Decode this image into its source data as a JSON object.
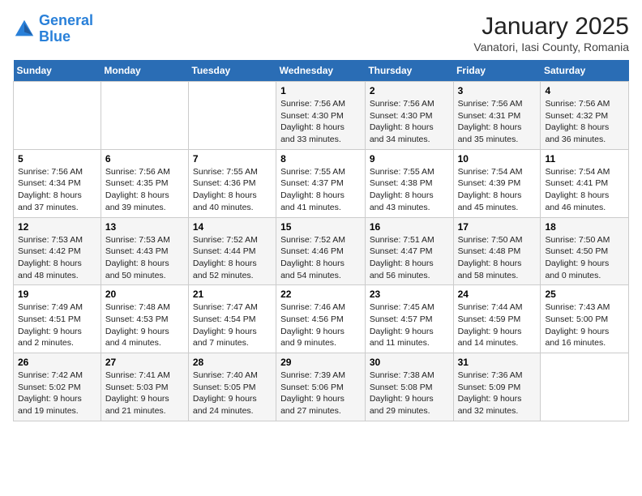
{
  "header": {
    "logo_line1": "General",
    "logo_line2": "Blue",
    "month": "January 2025",
    "location": "Vanatori, Iasi County, Romania"
  },
  "weekdays": [
    "Sunday",
    "Monday",
    "Tuesday",
    "Wednesday",
    "Thursday",
    "Friday",
    "Saturday"
  ],
  "weeks": [
    [
      {
        "day": "",
        "detail": ""
      },
      {
        "day": "",
        "detail": ""
      },
      {
        "day": "",
        "detail": ""
      },
      {
        "day": "1",
        "detail": "Sunrise: 7:56 AM\nSunset: 4:30 PM\nDaylight: 8 hours\nand 33 minutes."
      },
      {
        "day": "2",
        "detail": "Sunrise: 7:56 AM\nSunset: 4:30 PM\nDaylight: 8 hours\nand 34 minutes."
      },
      {
        "day": "3",
        "detail": "Sunrise: 7:56 AM\nSunset: 4:31 PM\nDaylight: 8 hours\nand 35 minutes."
      },
      {
        "day": "4",
        "detail": "Sunrise: 7:56 AM\nSunset: 4:32 PM\nDaylight: 8 hours\nand 36 minutes."
      }
    ],
    [
      {
        "day": "5",
        "detail": "Sunrise: 7:56 AM\nSunset: 4:34 PM\nDaylight: 8 hours\nand 37 minutes."
      },
      {
        "day": "6",
        "detail": "Sunrise: 7:56 AM\nSunset: 4:35 PM\nDaylight: 8 hours\nand 39 minutes."
      },
      {
        "day": "7",
        "detail": "Sunrise: 7:55 AM\nSunset: 4:36 PM\nDaylight: 8 hours\nand 40 minutes."
      },
      {
        "day": "8",
        "detail": "Sunrise: 7:55 AM\nSunset: 4:37 PM\nDaylight: 8 hours\nand 41 minutes."
      },
      {
        "day": "9",
        "detail": "Sunrise: 7:55 AM\nSunset: 4:38 PM\nDaylight: 8 hours\nand 43 minutes."
      },
      {
        "day": "10",
        "detail": "Sunrise: 7:54 AM\nSunset: 4:39 PM\nDaylight: 8 hours\nand 45 minutes."
      },
      {
        "day": "11",
        "detail": "Sunrise: 7:54 AM\nSunset: 4:41 PM\nDaylight: 8 hours\nand 46 minutes."
      }
    ],
    [
      {
        "day": "12",
        "detail": "Sunrise: 7:53 AM\nSunset: 4:42 PM\nDaylight: 8 hours\nand 48 minutes."
      },
      {
        "day": "13",
        "detail": "Sunrise: 7:53 AM\nSunset: 4:43 PM\nDaylight: 8 hours\nand 50 minutes."
      },
      {
        "day": "14",
        "detail": "Sunrise: 7:52 AM\nSunset: 4:44 PM\nDaylight: 8 hours\nand 52 minutes."
      },
      {
        "day": "15",
        "detail": "Sunrise: 7:52 AM\nSunset: 4:46 PM\nDaylight: 8 hours\nand 54 minutes."
      },
      {
        "day": "16",
        "detail": "Sunrise: 7:51 AM\nSunset: 4:47 PM\nDaylight: 8 hours\nand 56 minutes."
      },
      {
        "day": "17",
        "detail": "Sunrise: 7:50 AM\nSunset: 4:48 PM\nDaylight: 8 hours\nand 58 minutes."
      },
      {
        "day": "18",
        "detail": "Sunrise: 7:50 AM\nSunset: 4:50 PM\nDaylight: 9 hours\nand 0 minutes."
      }
    ],
    [
      {
        "day": "19",
        "detail": "Sunrise: 7:49 AM\nSunset: 4:51 PM\nDaylight: 9 hours\nand 2 minutes."
      },
      {
        "day": "20",
        "detail": "Sunrise: 7:48 AM\nSunset: 4:53 PM\nDaylight: 9 hours\nand 4 minutes."
      },
      {
        "day": "21",
        "detail": "Sunrise: 7:47 AM\nSunset: 4:54 PM\nDaylight: 9 hours\nand 7 minutes."
      },
      {
        "day": "22",
        "detail": "Sunrise: 7:46 AM\nSunset: 4:56 PM\nDaylight: 9 hours\nand 9 minutes."
      },
      {
        "day": "23",
        "detail": "Sunrise: 7:45 AM\nSunset: 4:57 PM\nDaylight: 9 hours\nand 11 minutes."
      },
      {
        "day": "24",
        "detail": "Sunrise: 7:44 AM\nSunset: 4:59 PM\nDaylight: 9 hours\nand 14 minutes."
      },
      {
        "day": "25",
        "detail": "Sunrise: 7:43 AM\nSunset: 5:00 PM\nDaylight: 9 hours\nand 16 minutes."
      }
    ],
    [
      {
        "day": "26",
        "detail": "Sunrise: 7:42 AM\nSunset: 5:02 PM\nDaylight: 9 hours\nand 19 minutes."
      },
      {
        "day": "27",
        "detail": "Sunrise: 7:41 AM\nSunset: 5:03 PM\nDaylight: 9 hours\nand 21 minutes."
      },
      {
        "day": "28",
        "detail": "Sunrise: 7:40 AM\nSunset: 5:05 PM\nDaylight: 9 hours\nand 24 minutes."
      },
      {
        "day": "29",
        "detail": "Sunrise: 7:39 AM\nSunset: 5:06 PM\nDaylight: 9 hours\nand 27 minutes."
      },
      {
        "day": "30",
        "detail": "Sunrise: 7:38 AM\nSunset: 5:08 PM\nDaylight: 9 hours\nand 29 minutes."
      },
      {
        "day": "31",
        "detail": "Sunrise: 7:36 AM\nSunset: 5:09 PM\nDaylight: 9 hours\nand 32 minutes."
      },
      {
        "day": "",
        "detail": ""
      }
    ]
  ]
}
